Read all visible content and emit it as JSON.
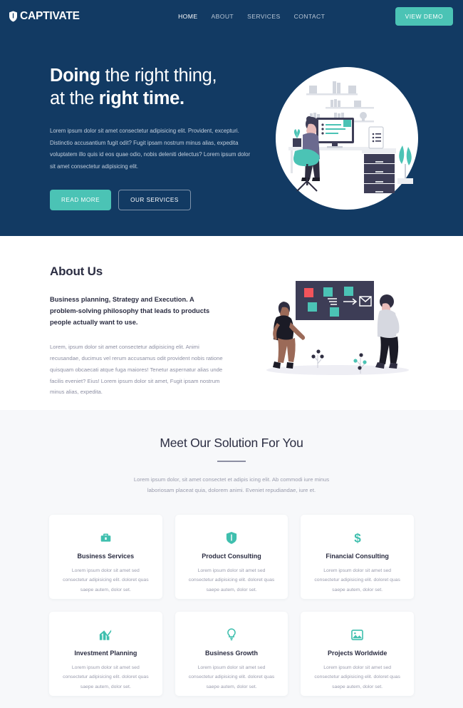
{
  "nav": {
    "logo_text": "CAPTIVATE",
    "logo_icon": "shield-icon",
    "links": [
      {
        "label": "HOME",
        "active": true
      },
      {
        "label": "ABOUT",
        "active": false
      },
      {
        "label": "SERVICES",
        "active": false
      },
      {
        "label": "CONTACT",
        "active": false
      }
    ],
    "cta_label": "VIEW DEMO"
  },
  "hero": {
    "title_line1_bold": "Doing",
    "title_line1_rest": " the right thing,",
    "title_line2_rest": "at the ",
    "title_line2_bold": "right time.",
    "paragraph": "Lorem ipsum dolor sit amet consectetur adipisicing elit. Provident, excepturi. Distinctio accusantium fugit odit? Fugit ipsam nostrum minus alias, expedita voluptatem illo quis id eos quae odio, nobis deleniti delectus? Lorem ipsum dolor sit amet consectetur adipisicing elit.",
    "primary_button": "READ MORE",
    "secondary_button": "OUR SERVICES",
    "illustration": "woman-at-desk-workspace-illustration"
  },
  "about": {
    "title": "About Us",
    "lead": "Business planning, Strategy and Execution. A problem-solving philosophy that leads to products people actually want to use.",
    "paragraph": "Lorem, ipsum dolor sit amet consectetur adipisicing elit. Animi recusandae, ducimus vel rerum accusamus odit provident nobis ratione quisquam obcaecati atque fuga maiores! Tenetur aspernatur alias unde facilis eveniet? Eius! Lorem ipsum dolor sit amet, Fugit ipsam nostrum minus alias, expedita.",
    "illustration": "two-people-presentation-board-illustration"
  },
  "solutions": {
    "title": "Meet Our Solution For You",
    "subtitle": "Lorem ipsum dolor, sit amet consectet et adipis icing elit. Ab commodi iure minus laboriosam placeat quia, dolorem animi. Eveniet repudiandae, iure et.",
    "card_body": "Lorem ipsum dolor sit amet sed consectetur adipisicing elit. doloret quas saepe autem, dolor set.",
    "cards": [
      {
        "title": "Business Services",
        "icon": "briefcase-icon"
      },
      {
        "title": "Product Consulting",
        "icon": "shield-icon"
      },
      {
        "title": "Financial Consulting",
        "icon": "dollar-icon"
      },
      {
        "title": "Investment Planning",
        "icon": "bar-chart-icon"
      },
      {
        "title": "Business Growth",
        "icon": "lightbulb-icon"
      },
      {
        "title": "Projects Worldwide",
        "icon": "image-icon"
      }
    ]
  },
  "colors": {
    "navy": "#123a63",
    "teal": "#4bc3b5",
    "icon_teal": "#3fbfae",
    "dark_text": "#2b2d42",
    "muted_text": "#9a9cad",
    "section_gray": "#f7f8fa"
  }
}
